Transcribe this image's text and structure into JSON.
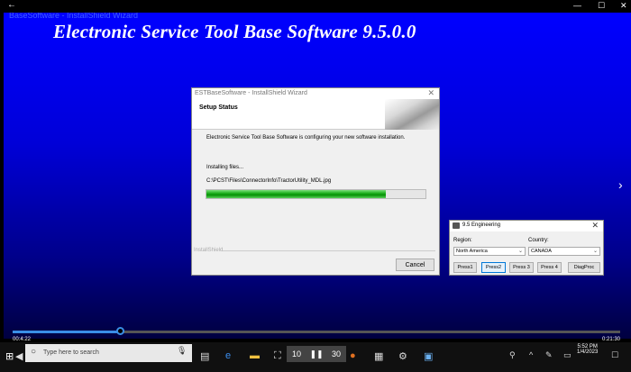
{
  "player": {
    "window_title": "BaseSoftware - InstallShield Wizard",
    "back_icon": "back-arrow-icon",
    "minimize": "—",
    "maximize": "☐",
    "close": "✕"
  },
  "installer_bg": {
    "title": "Electronic Service Tool Base Software 9.5.0.0",
    "ghost_text": "..."
  },
  "dialog": {
    "title": "ESTBaseSoftware - InstallShield Wizard",
    "header_title": "Setup Status",
    "message": "Electronic Service Tool Base Software is configuring your new software installation.",
    "status": "Installing files...",
    "file_path": "C:\\PCST\\Files\\ConnectorInfo\\TractorUtility_MDL.jpg",
    "progress_fraction": 0.82,
    "footer_label": "InstallShield",
    "cancel_label": "Cancel",
    "close": "✕"
  },
  "engineering": {
    "title": "9.5  Engineering",
    "region_label": "Region:",
    "region_value": "North America",
    "country_label": "Country:",
    "country_value": "CANADA",
    "buttons": [
      "Press1",
      "Press2",
      "Press 3",
      "Press 4",
      "DiagProc"
    ],
    "close": "✕"
  },
  "seek": {
    "elapsed": "00:4:22",
    "total": "0:21:30",
    "progress_fraction": 0.18
  },
  "taskbar": {
    "search_placeholder": "Type here to search",
    "clock_time": "5:52 PM",
    "clock_date": "1/4/2023",
    "skip_back": "10",
    "skip_fwd": "30",
    "play_pause": "❚❚"
  },
  "colors": {
    "installer_blue": "#0000ff",
    "progress_green": "#069006",
    "seek_blue": "#3a8ee6"
  }
}
